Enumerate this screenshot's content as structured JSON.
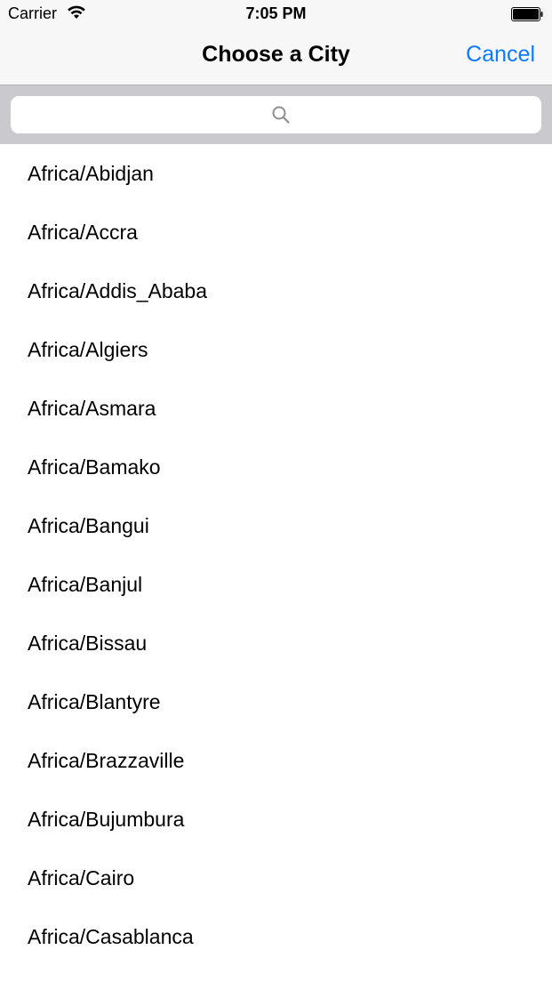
{
  "status_bar": {
    "carrier": "Carrier",
    "time": "7:05 PM",
    "wifi_icon": "wifi-icon",
    "battery_icon": "battery-icon"
  },
  "nav": {
    "title": "Choose a City",
    "cancel_label": "Cancel",
    "accent_color": "#0a7aff"
  },
  "search": {
    "placeholder": "",
    "value": "",
    "icon": "search-icon"
  },
  "cities": [
    "Africa/Abidjan",
    "Africa/Accra",
    "Africa/Addis_Ababa",
    "Africa/Algiers",
    "Africa/Asmara",
    "Africa/Bamako",
    "Africa/Bangui",
    "Africa/Banjul",
    "Africa/Bissau",
    "Africa/Blantyre",
    "Africa/Brazzaville",
    "Africa/Bujumbura",
    "Africa/Cairo",
    "Africa/Casablanca"
  ]
}
